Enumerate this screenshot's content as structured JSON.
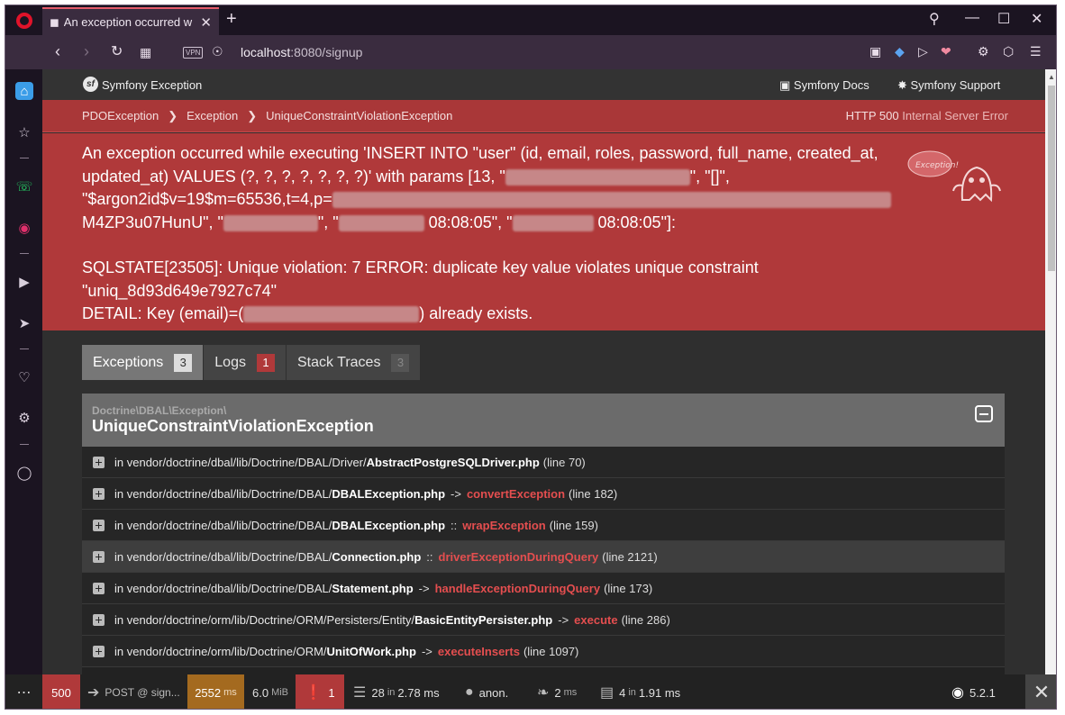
{
  "browser": {
    "tab_title": "An exception occurred w",
    "url_host": "localhost",
    "url_rest": ":8080/signup",
    "vpn_label": "VPN"
  },
  "header": {
    "title": "Symfony Exception",
    "docs_label": "Symfony Docs",
    "support_label": "Symfony Support"
  },
  "breadcrumbs": [
    "PDOException",
    "Exception",
    "UniqueConstraintViolationException"
  ],
  "http_status": {
    "code": "HTTP 500",
    "text": "Internal Server Error"
  },
  "message": {
    "l1": "An exception occurred while executing 'INSERT INTO \"user\" (id, email, roles, password, full_name, created_at,",
    "l2a": "updated_at) VALUES (?, ?, ?, ?, ?, ?, ?)' with params [13, \"",
    "l2b": "\", \"[]\",",
    "l3a": "\"$argon2id$v=19$m=65536,t=4,p=",
    "l4a": "M4ZP3u07HunU\", \"",
    "l4b": "\", \"",
    "l4c": " 08:08:05\", \"",
    "l4d": " 08:08:05\"]:",
    "l5": "SQLSTATE[23505]: Unique violation: 7 ERROR: duplicate key value violates unique constraint",
    "l6": "\"uniq_8d93d649e7927c74\"",
    "l7a": "DETAIL: Key (email)=(",
    "l7b": ") already exists."
  },
  "tabs": [
    {
      "label": "Exceptions",
      "count": "3"
    },
    {
      "label": "Logs",
      "count": "1"
    },
    {
      "label": "Stack Traces",
      "count": "3"
    }
  ],
  "exception": {
    "namespace": "Doctrine\\DBAL\\Exception\\",
    "class": "UniqueConstraintViolationException"
  },
  "frames": [
    {
      "path": "in vendor/doctrine/dbal/lib/Doctrine/DBAL/Driver/",
      "file": "AbstractPostgreSQLDriver.php",
      "op": "",
      "fn": "",
      "line": "(line 70)"
    },
    {
      "path": "in vendor/doctrine/dbal/lib/Doctrine/DBAL/",
      "file": "DBALException.php",
      "op": "->",
      "fn": "convertException",
      "line": "(line 182)"
    },
    {
      "path": "in vendor/doctrine/dbal/lib/Doctrine/DBAL/",
      "file": "DBALException.php",
      "op": "::",
      "fn": "wrapException",
      "line": "(line 159)"
    },
    {
      "path": "in vendor/doctrine/dbal/lib/Doctrine/DBAL/",
      "file": "Connection.php",
      "op": "::",
      "fn": "driverExceptionDuringQuery",
      "line": "(line 2121)"
    },
    {
      "path": "in vendor/doctrine/dbal/lib/Doctrine/DBAL/",
      "file": "Statement.php",
      "op": "->",
      "fn": "handleExceptionDuringQuery",
      "line": "(line 173)"
    },
    {
      "path": "in vendor/doctrine/orm/lib/Doctrine/ORM/Persisters/Entity/",
      "file": "BasicEntityPersister.php",
      "op": "->",
      "fn": "execute",
      "line": "(line 286)"
    },
    {
      "path": "in vendor/doctrine/orm/lib/Doctrine/ORM/",
      "file": "UnitOfWork.php",
      "op": "->",
      "fn": "executeInserts",
      "line": "(line 1097)"
    }
  ],
  "toolbar": {
    "status": "500",
    "request": "POST @ sign...",
    "time_value": "2552",
    "time_unit": "ms",
    "memory_value": "6.0",
    "memory_unit": "MiB",
    "errors": "1",
    "db_value": "28",
    "db_in": "in",
    "db_time": "2.78 ms",
    "user": "anon.",
    "twig_value": "2",
    "twig_unit": "ms",
    "cache_value": "4",
    "cache_in": "in",
    "cache_time": "1.91 ms",
    "version": "5.2.1"
  },
  "ghost_caption": "Exception!",
  "colors": {
    "error_red": "#b0393a",
    "accent_link_red": "#e44e4f",
    "toolbar_orange": "#a46a1f"
  }
}
